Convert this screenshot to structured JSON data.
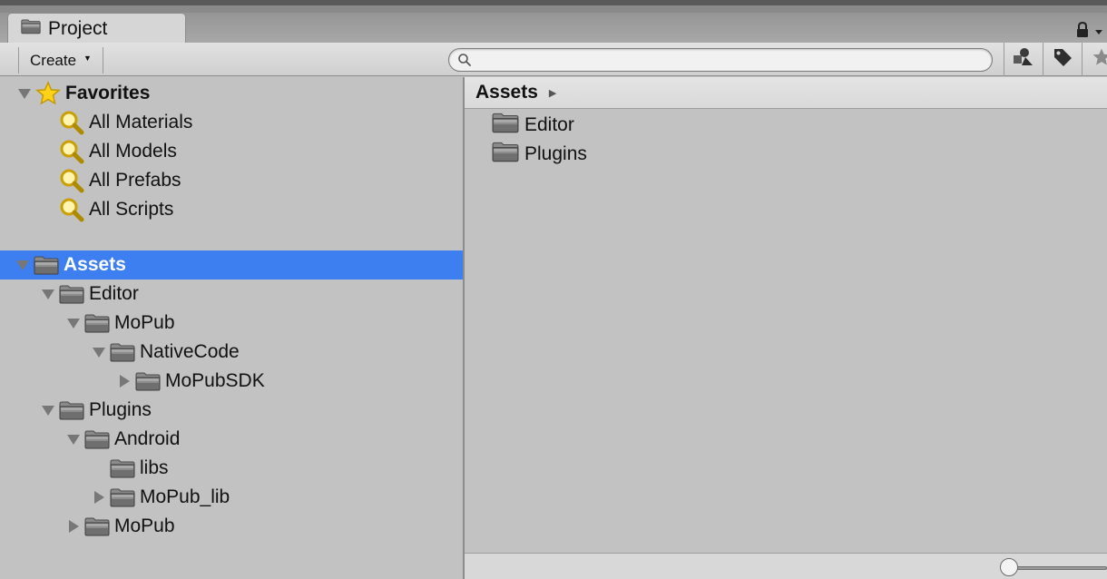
{
  "window": {
    "tab_label": "Project",
    "tab_icon": "folder-icon"
  },
  "toolbar": {
    "create_label": "Create",
    "search_placeholder": "",
    "search_value": "",
    "buttons": [
      "filter-by-type-icon",
      "filter-by-label-icon",
      "favorite-star-icon"
    ]
  },
  "tree": {
    "favorites": {
      "label": "Favorites",
      "items": [
        "All Materials",
        "All Models",
        "All Prefabs",
        "All Scripts"
      ]
    },
    "assets_label": "Assets",
    "nodes": [
      {
        "label": "Editor",
        "expanded": true
      },
      {
        "label": "MoPub",
        "expanded": true
      },
      {
        "label": "NativeCode",
        "expanded": true
      },
      {
        "label": "MoPubSDK",
        "expanded": false
      },
      {
        "label": "Plugins",
        "expanded": true
      },
      {
        "label": "Android",
        "expanded": true
      },
      {
        "label": "libs",
        "expanded": null
      },
      {
        "label": "MoPub_lib",
        "expanded": false
      },
      {
        "label": "MoPub",
        "expanded": false
      }
    ]
  },
  "content": {
    "breadcrumb": "Assets",
    "items": [
      "Editor",
      "Plugins"
    ]
  },
  "colors": {
    "selection": "#3d7ef0",
    "pane_bg": "#c2c2c2"
  }
}
